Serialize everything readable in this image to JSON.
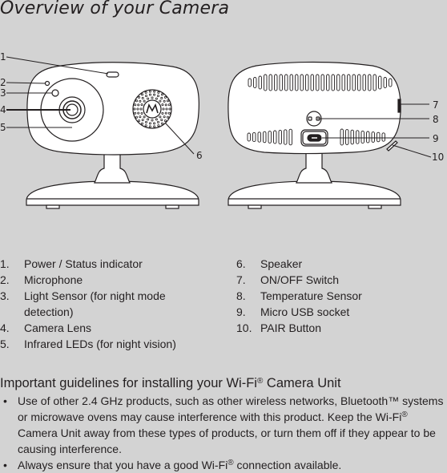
{
  "page": {
    "title": "Overview of your Camera"
  },
  "diagram": {
    "front_view_callouts": [
      "1",
      "2",
      "3",
      "4",
      "5",
      "6"
    ],
    "back_view_callouts": [
      "7",
      "8",
      "9",
      "10"
    ],
    "logo_icon": "motorola-logo-icon"
  },
  "legend": {
    "left": [
      {
        "num": "1.",
        "label": "Power / Status indicator"
      },
      {
        "num": "2.",
        "label": "Microphone"
      },
      {
        "num": "3.",
        "label": "Light Sensor (for night mode detection)"
      },
      {
        "num": "4.",
        "label": "Camera Lens"
      },
      {
        "num": "5.",
        "label": "Infrared LEDs (for night vision)"
      }
    ],
    "right": [
      {
        "num": "6.",
        "label": "Speaker"
      },
      {
        "num": "7.",
        "label": "ON/OFF Switch"
      },
      {
        "num": "8.",
        "label": "Temperature Sensor"
      },
      {
        "num": "9.",
        "label": "Micro USB socket"
      },
      {
        "num": "10.",
        "label": "PAIR Button"
      }
    ]
  },
  "guidelines": {
    "heading_pre": "Important guidelines for installing your Wi-Fi",
    "heading_sup": "®",
    "heading_post": " Camera Unit",
    "bullet_glyph": "•",
    "items": [
      {
        "pre": "Use of other 2.4 GHz products, such as other wireless networks, Bluetooth™ systems or microwave ovens may cause interference with this product. Keep the Wi-Fi",
        "sup": "®",
        "post": " Camera Unit away from these types of products, or turn them off if they appear to be causing interference."
      },
      {
        "pre": "Always ensure that you have a good Wi-Fi",
        "sup": "®",
        "post": " connection available."
      }
    ]
  }
}
